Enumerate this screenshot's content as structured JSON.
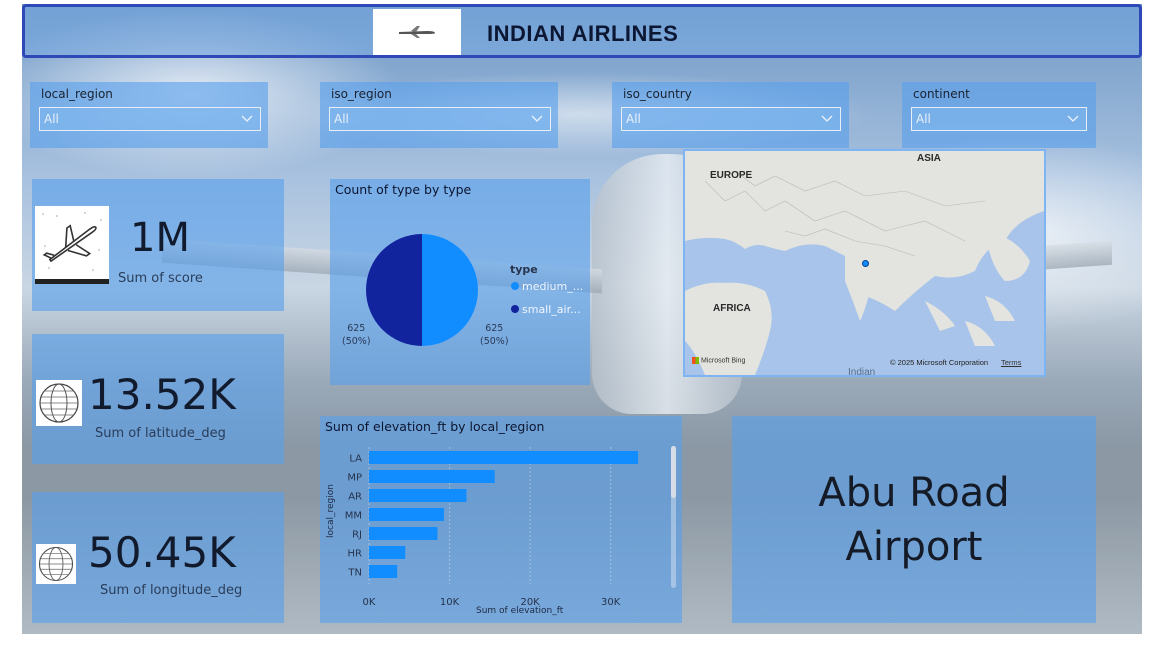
{
  "header": {
    "title": "INDIAN AIRLINES",
    "logo_icon": "airplane-icon"
  },
  "slicers": [
    {
      "label": "local_region",
      "value": "All"
    },
    {
      "label": "iso_region",
      "value": "All"
    },
    {
      "label": "iso_country",
      "value": "All"
    },
    {
      "label": "continent",
      "value": "All"
    }
  ],
  "kpis": [
    {
      "value": "1M",
      "label": "Sum of score",
      "icon": "airplane-sketch-icon"
    },
    {
      "value": "13.52K",
      "label": "Sum of latitude_deg",
      "icon": "globe-icon"
    },
    {
      "value": "50.45K",
      "label": "Sum of longitude_deg",
      "icon": "globe-icon"
    }
  ],
  "pie": {
    "title": "Count of type by type",
    "legend_title": "type",
    "chart_data": {
      "type": "pie",
      "slices": [
        {
          "name": "medium_...",
          "value": 625,
          "pct": "(50%)",
          "color": "#118dff"
        },
        {
          "name": "small_air...",
          "value": 625,
          "pct": "(50%)",
          "color": "#12239e"
        }
      ]
    }
  },
  "map": {
    "labels": {
      "europe": "EUROPE",
      "asia": "ASIA",
      "africa": "AFRICA",
      "indian": "Indian"
    },
    "attribution": "© 2025 Microsoft Corporation",
    "terms": "Terms",
    "bing": "Microsoft Bing"
  },
  "bar": {
    "title": "Sum of elevation_ft by local_region",
    "chart_data": {
      "type": "bar",
      "orientation": "horizontal",
      "categories": [
        "LA",
        "MP",
        "AR",
        "MM",
        "RJ",
        "HR",
        "TN"
      ],
      "values": [
        33400,
        15600,
        12100,
        9300,
        8500,
        4500,
        3500
      ],
      "xlabel": "Sum of elevation_ft",
      "ylabel": "local_region",
      "xticks": [
        "0K",
        "10K",
        "20K",
        "30K"
      ],
      "xlim": [
        0,
        36000
      ],
      "color": "#118dff"
    }
  },
  "card": {
    "line1": "Abu Road",
    "line2": "Airport"
  }
}
